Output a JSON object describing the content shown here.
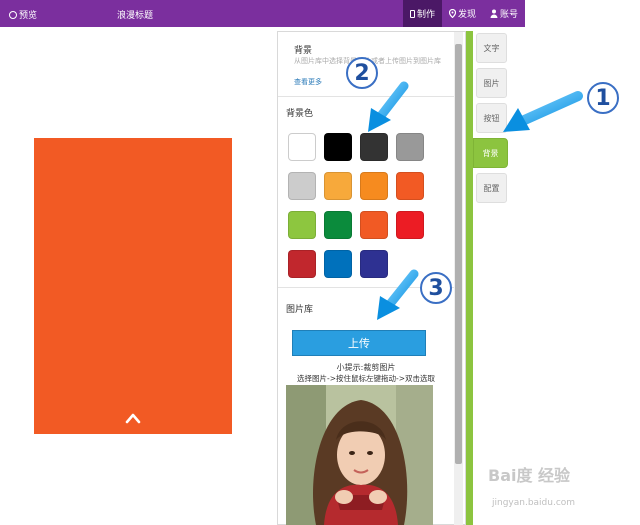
{
  "topbar": {
    "preview_label": "预览",
    "title": "浪漫标题",
    "nav": [
      {
        "label": "制作",
        "active": true
      },
      {
        "label": "发现",
        "active": false
      },
      {
        "label": "账号",
        "active": false
      }
    ]
  },
  "panel": {
    "background_section": {
      "heading": "背景",
      "description": "从图片库中选择背景图片或者上传图片到图片库",
      "more_link": "查看更多"
    },
    "bg_color_label": "背景色",
    "swatch_colors": [
      "#ffffff",
      "#000000",
      "#333333",
      "#999999",
      "#cccccc",
      "#f7a93b",
      "#f68b1f",
      "#f25a24",
      "#8dc63f",
      "#0b8b3c",
      "#f15a24",
      "#ec1c24",
      "#c1272d",
      "#0071bc",
      "#2e3192"
    ],
    "gallery_label": "图片库",
    "upload_button": "上传",
    "tip_title": "小提示:裁剪图片",
    "tip_steps": "选择图片->按住鼠标左键拖动->双击选取"
  },
  "tabs": [
    {
      "label": "文字",
      "active": false
    },
    {
      "label": "图片",
      "active": false
    },
    {
      "label": "按钮",
      "active": false
    },
    {
      "label": "背景",
      "active": true
    },
    {
      "label": "配置",
      "active": false
    }
  ],
  "annotations": [
    "1",
    "2",
    "3"
  ],
  "colors": {
    "topbar": "#7b2f9e",
    "topbar_active": "#4b1866",
    "accent_green": "#8cc43f",
    "phone_background": "#f25a24",
    "upload_blue": "#2a9ee0",
    "arrow_blue": "#1ea7f0"
  },
  "watermark": {
    "brand": "Bai度 经验",
    "url": "jingyan.baidu.com"
  }
}
